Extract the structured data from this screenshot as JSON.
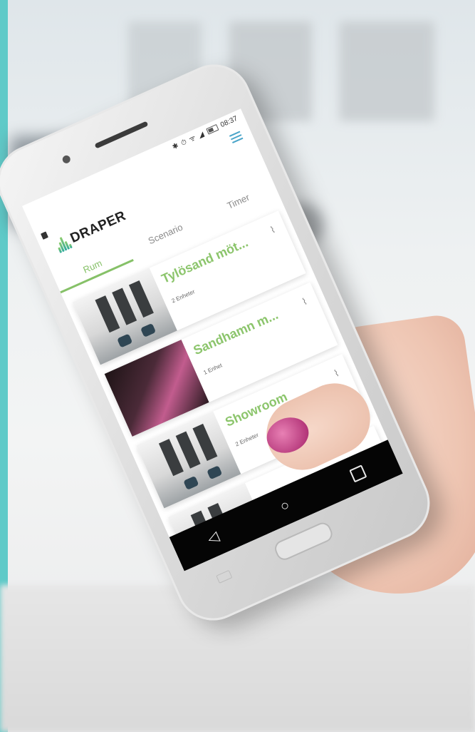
{
  "status_bar": {
    "time": "08:37",
    "icons": "✱ ⏱ ᯤ ◢"
  },
  "header": {
    "logo_text": "DRAPER"
  },
  "tabs": [
    {
      "label": "Rum",
      "active": true
    },
    {
      "label": "Scenario",
      "active": false
    },
    {
      "label": "Timer",
      "active": false
    }
  ],
  "rooms": [
    {
      "title": "Tylösand möt...",
      "subtitle": "2 Enheter",
      "image": "office"
    },
    {
      "title": "Sandhamn m...",
      "subtitle": "1 Enhet",
      "image": "dark-room"
    },
    {
      "title": "Showroom",
      "subtitle": "2 Enheter",
      "image": "office"
    }
  ],
  "nav": {
    "back": "◁",
    "home": "○",
    "recent": "□"
  },
  "colors": {
    "accent_bar": "#5fcac8",
    "tab_active": "#86c168",
    "card_title": "#8cc56c",
    "menu_icon": "#4aa5c9"
  }
}
